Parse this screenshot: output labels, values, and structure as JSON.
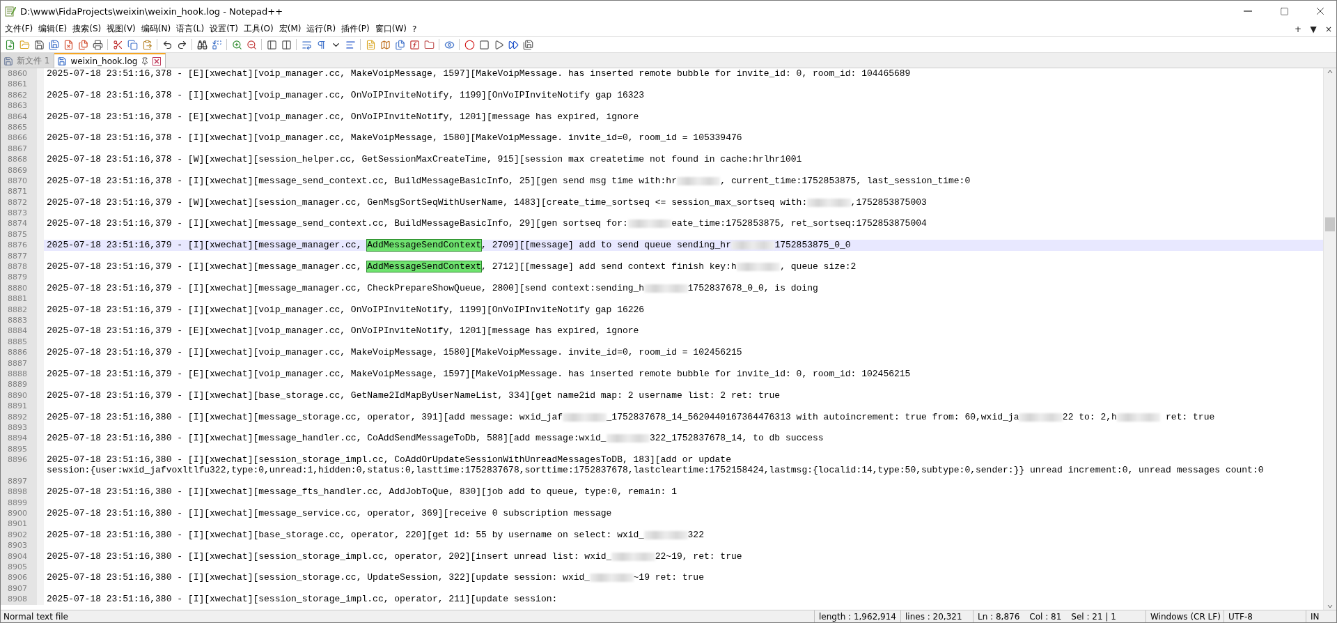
{
  "window": {
    "title": "D:\\www\\FidaProjects\\weixin\\weixin_hook.log - Notepad++"
  },
  "menu": [
    "文件(F)",
    "编辑(E)",
    "搜索(S)",
    "视图(V)",
    "编码(N)",
    "语言(L)",
    "设置(T)",
    "工具(O)",
    "宏(M)",
    "运行(R)",
    "插件(P)",
    "窗口(W)",
    "?"
  ],
  "menu_right": [
    "+",
    "▼",
    "×"
  ],
  "tabs": [
    {
      "label": "新文件 1",
      "selected": false
    },
    {
      "label": "weixin_hook.log",
      "selected": true
    }
  ],
  "lines": [
    {
      "number": "8860",
      "current": false,
      "segments": [
        {
          "kind": "text",
          "text": "2025-07-18 23:51:16,378 - [E][xwechat][voip_manager.cc, MakeVoipMessage, 1597][MakeVoipMessage. has inserted remote bubble for invite_id: 0, room_id: 104465689"
        }
      ]
    },
    {
      "number": "8861",
      "current": false
    },
    {
      "number": "8862",
      "current": false,
      "segments": [
        {
          "kind": "text",
          "text": "2025-07-18 23:51:16,378 - [I][xwechat][voip_manager.cc, OnVoIPInviteNotify, 1199][OnVoIPInviteNotify gap 16323"
        }
      ]
    },
    {
      "number": "8863",
      "current": false
    },
    {
      "number": "8864",
      "current": false,
      "segments": [
        {
          "kind": "text",
          "text": "2025-07-18 23:51:16,378 - [E][xwechat][voip_manager.cc, OnVoIPInviteNotify, 1201][message has expired, ignore"
        }
      ]
    },
    {
      "number": "8865",
      "current": false
    },
    {
      "number": "8866",
      "current": false,
      "segments": [
        {
          "kind": "text",
          "text": "2025-07-18 23:51:16,378 - [I][xwechat][voip_manager.cc, MakeVoipMessage, 1580][MakeVoipMessage. invite_id=0, room_id = 105339476"
        }
      ]
    },
    {
      "number": "8867",
      "current": false
    },
    {
      "number": "8868",
      "current": false,
      "segments": [
        {
          "kind": "text",
          "text": "2025-07-18 23:51:16,378 - [W][xwechat][session_helper.cc, GetSessionMaxCreateTime, 915][session max createtime not found in cache:hrlhr1001"
        }
      ]
    },
    {
      "number": "8869",
      "current": false
    },
    {
      "number": "8870",
      "current": false,
      "segments": [
        {
          "kind": "text",
          "text": "2025-07-18 23:51:16,378 - [I][xwechat][message_send_context.cc, BuildMessageBasicInfo, 25][gen send msg time with:hr"
        },
        {
          "kind": "redacted"
        },
        {
          "kind": "text",
          "text": ", current_time:1752853875, last_session_time:0"
        }
      ]
    },
    {
      "number": "8871",
      "current": false
    },
    {
      "number": "8872",
      "current": false,
      "segments": [
        {
          "kind": "text",
          "text": "2025-07-18 23:51:16,379 - [W][xwechat][session_manager.cc, GenMsgSortSeqWithUserName, 1483][create_time_sortseq <= session_max_sortseq with:"
        },
        {
          "kind": "redacted"
        },
        {
          "kind": "text",
          "text": ",1752853875003"
        }
      ]
    },
    {
      "number": "8873",
      "current": false
    },
    {
      "number": "8874",
      "current": false,
      "segments": [
        {
          "kind": "text",
          "text": "2025-07-18 23:51:16,379 - [I][xwechat][message_send_context.cc, BuildMessageBasicInfo, 29][gen sortseq for:"
        },
        {
          "kind": "redacted"
        },
        {
          "kind": "text",
          "text": "eate_time:1752853875, ret_sortseq:1752853875004"
        }
      ]
    },
    {
      "number": "8875",
      "current": false
    },
    {
      "number": "8876",
      "current": true,
      "segments": [
        {
          "kind": "text",
          "text": "2025-07-18 23:51:16,379 - [I][xwechat][message_manager.cc, "
        },
        {
          "kind": "match",
          "text": "AddMessageSendContext"
        },
        {
          "kind": "text",
          "text": ", 2709][[message] add to send queue sending_hr"
        },
        {
          "kind": "redacted"
        },
        {
          "kind": "text",
          "text": "1752853875_0_0"
        }
      ]
    },
    {
      "number": "8877",
      "current": false
    },
    {
      "number": "8878",
      "current": false,
      "segments": [
        {
          "kind": "text",
          "text": "2025-07-18 23:51:16,379 - [I][xwechat][message_manager.cc, "
        },
        {
          "kind": "match",
          "text": "AddMessageSendContext"
        },
        {
          "kind": "text",
          "text": ", 2712][[message] add send context finish key:h"
        },
        {
          "kind": "redacted"
        },
        {
          "kind": "text",
          "text": ", queue size:2"
        }
      ]
    },
    {
      "number": "8879",
      "current": false
    },
    {
      "number": "8880",
      "current": false,
      "segments": [
        {
          "kind": "text",
          "text": "2025-07-18 23:51:16,379 - [I][xwechat][message_manager.cc, CheckPrepareShowQueue, 2800][send context:sending_h"
        },
        {
          "kind": "redacted"
        },
        {
          "kind": "text",
          "text": "1752837678_0_0, is doing"
        }
      ]
    },
    {
      "number": "8881",
      "current": false
    },
    {
      "number": "8882",
      "current": false,
      "segments": [
        {
          "kind": "text",
          "text": "2025-07-18 23:51:16,379 - [I][xwechat][voip_manager.cc, OnVoIPInviteNotify, 1199][OnVoIPInviteNotify gap 16226"
        }
      ]
    },
    {
      "number": "8883",
      "current": false
    },
    {
      "number": "8884",
      "current": false,
      "segments": [
        {
          "kind": "text",
          "text": "2025-07-18 23:51:16,379 - [E][xwechat][voip_manager.cc, OnVoIPInviteNotify, 1201][message has expired, ignore"
        }
      ]
    },
    {
      "number": "8885",
      "current": false
    },
    {
      "number": "8886",
      "current": false,
      "segments": [
        {
          "kind": "text",
          "text": "2025-07-18 23:51:16,379 - [I][xwechat][voip_manager.cc, MakeVoipMessage, 1580][MakeVoipMessage. invite_id=0, room_id = 102456215"
        }
      ]
    },
    {
      "number": "8887",
      "current": false
    },
    {
      "number": "8888",
      "current": false,
      "segments": [
        {
          "kind": "text",
          "text": "2025-07-18 23:51:16,379 - [E][xwechat][voip_manager.cc, MakeVoipMessage, 1597][MakeVoipMessage. has inserted remote bubble for invite_id: 0, room_id: 102456215"
        }
      ]
    },
    {
      "number": "8889",
      "current": false
    },
    {
      "number": "8890",
      "current": false,
      "segments": [
        {
          "kind": "text",
          "text": "2025-07-18 23:51:16,379 - [I][xwechat][base_storage.cc, GetName2IdMapByUserNameList, 334][get name2id map: 2 username list: 2 ret: true"
        }
      ]
    },
    {
      "number": "8891",
      "current": false
    },
    {
      "number": "8892",
      "current": false,
      "segments": [
        {
          "kind": "text",
          "text": "2025-07-18 23:51:16,380 - [I][xwechat][message_storage.cc, operator, 391][add message: wxid_jaf"
        },
        {
          "kind": "redacted"
        },
        {
          "kind": "text",
          "text": "_1752837678_14_5620440167364476313 with autoincrement: true from: 60,wxid_ja"
        },
        {
          "kind": "redacted"
        },
        {
          "kind": "text",
          "text": "22 to: 2,h"
        },
        {
          "kind": "redacted"
        },
        {
          "kind": "text",
          "text": " ret: true"
        }
      ]
    },
    {
      "number": "8893",
      "current": false
    },
    {
      "number": "8894",
      "current": false,
      "segments": [
        {
          "kind": "text",
          "text": "2025-07-18 23:51:16,380 - [I][xwechat][message_handler.cc, CoAddSendMessageToDb, 588][add message:wxid_"
        },
        {
          "kind": "redacted"
        },
        {
          "kind": "text",
          "text": "322_1752837678_14, to db success"
        }
      ]
    },
    {
      "number": "8895",
      "current": false
    },
    {
      "number": "8896",
      "current": false,
      "segments": [
        {
          "kind": "text",
          "text": "2025-07-18 23:51:16,380 - [I][xwechat][session_storage_impl.cc, CoAddOrUpdateSessionWithUnreadMessagesToDB, 183][add or update"
        }
      ],
      "wrapped": "session:{user:wxid_jafvoxltlfu322,type:0,unread:1,hidden:0,status:0,lasttime:1752837678,sorttime:1752837678,lastcleartime:1752158424,lastmsg:{localid:14,type:50,subtype:0,sender:}} unread increment:0, unread messages count:0"
    },
    {
      "number": "8897",
      "current": false
    },
    {
      "number": "8898",
      "current": false,
      "segments": [
        {
          "kind": "text",
          "text": "2025-07-18 23:51:16,380 - [I][xwechat][message_fts_handler.cc, AddJobToQue, 830][job add to queue, type:0, remain: 1"
        }
      ]
    },
    {
      "number": "8899",
      "current": false
    },
    {
      "number": "8900",
      "current": false,
      "segments": [
        {
          "kind": "text",
          "text": "2025-07-18 23:51:16,380 - [I][xwechat][message_service.cc, operator, 369][receive 0 subscription message"
        }
      ]
    },
    {
      "number": "8901",
      "current": false
    },
    {
      "number": "8902",
      "current": false,
      "segments": [
        {
          "kind": "text",
          "text": "2025-07-18 23:51:16,380 - [I][xwechat][base_storage.cc, operator, 220][get id: 55 by username on select: wxid_"
        },
        {
          "kind": "redacted"
        },
        {
          "kind": "text",
          "text": "322"
        }
      ]
    },
    {
      "number": "8903",
      "current": false
    },
    {
      "number": "8904",
      "current": false,
      "segments": [
        {
          "kind": "text",
          "text": "2025-07-18 23:51:16,380 - [I][xwechat][session_storage_impl.cc, operator, 202][insert unread list: wxid_"
        },
        {
          "kind": "redacted"
        },
        {
          "kind": "text",
          "text": "22~19, ret: true"
        }
      ]
    },
    {
      "number": "8905",
      "current": false
    },
    {
      "number": "8906",
      "current": false,
      "segments": [
        {
          "kind": "text",
          "text": "2025-07-18 23:51:16,380 - [I][xwechat][session_storage.cc, UpdateSession, 322][update session: wxid_"
        },
        {
          "kind": "redacted"
        },
        {
          "kind": "text",
          "text": "~19 ret: true"
        }
      ]
    },
    {
      "number": "8907",
      "current": false
    },
    {
      "number": "8908",
      "current": false,
      "segments": [
        {
          "kind": "text",
          "text": "2025-07-18 23:51:16,380 - [I][xwechat][session_storage_impl.cc, operator, 211][update session:"
        }
      ]
    }
  ],
  "status_bar": {
    "file_type": "Normal text file",
    "sections": [
      {
        "items": [
          "length : 1,962,914"
        ]
      },
      {
        "items": [
          "lines : 20,321"
        ]
      },
      {
        "items": [
          "Ln : 8,876",
          "Col : 81",
          "Sel : 21 | 1"
        ]
      },
      {
        "items": [
          "Windows (CR LF)"
        ]
      },
      {
        "items": [
          "UTF-8"
        ]
      },
      {
        "items": [
          "IN"
        ]
      }
    ]
  }
}
